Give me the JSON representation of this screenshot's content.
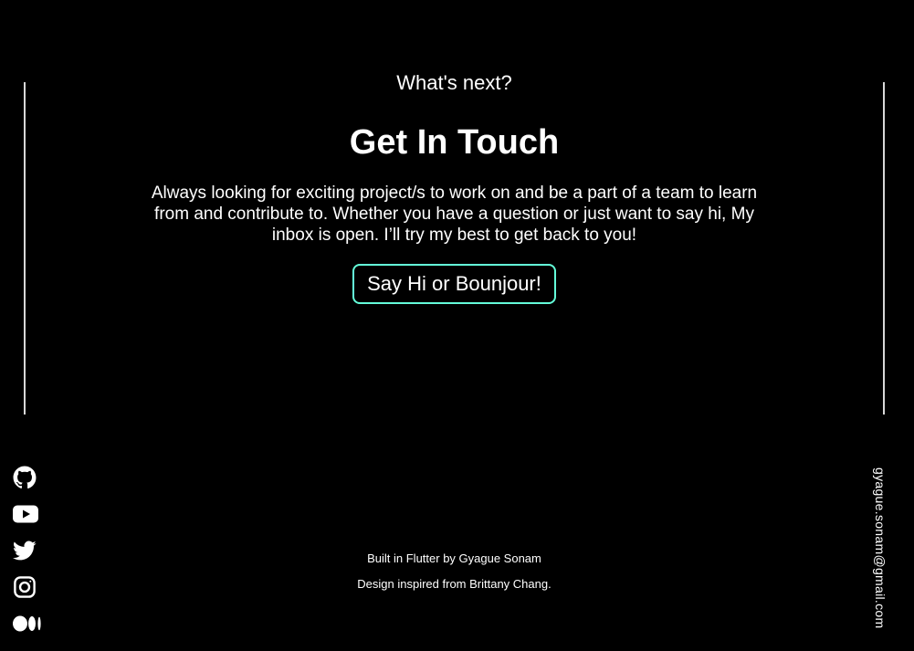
{
  "contact": {
    "eyebrow": "What's next?",
    "headline": "Get In Touch",
    "blurb": "Always looking for exciting project/s to work on and be a part of a team to learn from and contribute to. Whether you have a question or just want to say hi, My inbox is open. I’ll try my best to get back to you!",
    "cta_label": "Say Hi or Bounjour!"
  },
  "socials": [
    {
      "icon": "github-icon"
    },
    {
      "icon": "youtube-icon"
    },
    {
      "icon": "twitter-icon"
    },
    {
      "icon": "instagram-icon"
    },
    {
      "icon": "medium-icon"
    }
  ],
  "email": "gyague.sonam@gmail.com",
  "footer": {
    "built_by": "Built in Flutter by Gyague Sonam",
    "inspired_by": "Design inspired from Brittany Chang."
  },
  "colors": {
    "background": "#000000",
    "text": "#ffffff",
    "accent": "#64ffda",
    "rail": "#d8d8d8"
  }
}
